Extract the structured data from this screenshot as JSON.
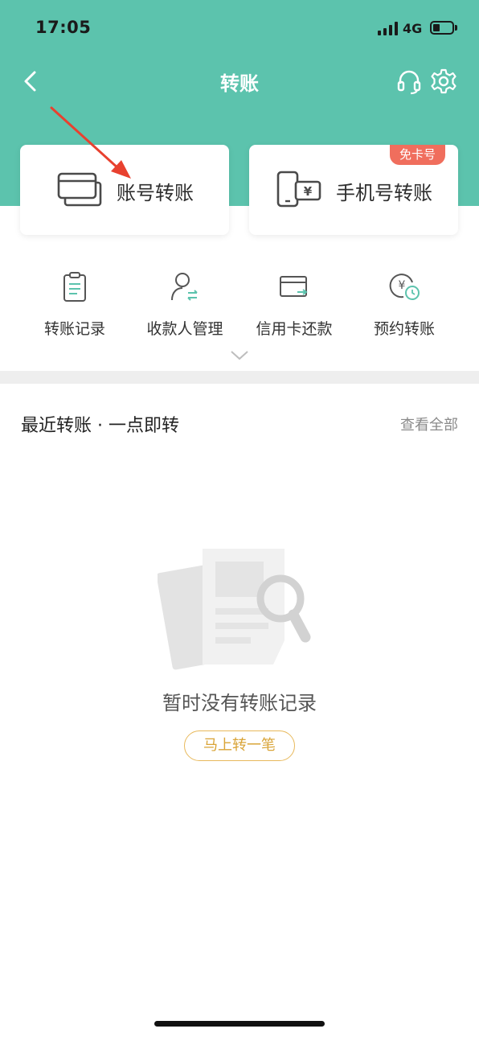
{
  "status_bar": {
    "time": "17:05",
    "network": "4G"
  },
  "header": {
    "title": "转账",
    "back_icon": "chevron-left-icon",
    "service_icon": "headset-icon",
    "settings_icon": "gear-icon"
  },
  "transfer_cards": [
    {
      "label": "账号转账",
      "icon": "bank-card-icon"
    },
    {
      "label": "手机号转账",
      "icon": "phone-yuan-icon",
      "badge": "免卡号"
    }
  ],
  "quick_menu": [
    {
      "label": "转账记录",
      "icon": "clipboard-icon"
    },
    {
      "label": "收款人管理",
      "icon": "payee-person-icon"
    },
    {
      "label": "信用卡还款",
      "icon": "credit-card-repay-icon"
    },
    {
      "label": "预约转账",
      "icon": "scheduled-yuan-icon"
    }
  ],
  "recent": {
    "title": "最近转账 · 一点即转",
    "view_all": "查看全部",
    "empty_text": "暂时没有转账记录",
    "action_button": "马上转一笔"
  },
  "colors": {
    "brand_green": "#5cc3ad",
    "badge_red": "#f06e5d",
    "action_gold": "#d9a437",
    "annotation_red": "#e8412f"
  }
}
